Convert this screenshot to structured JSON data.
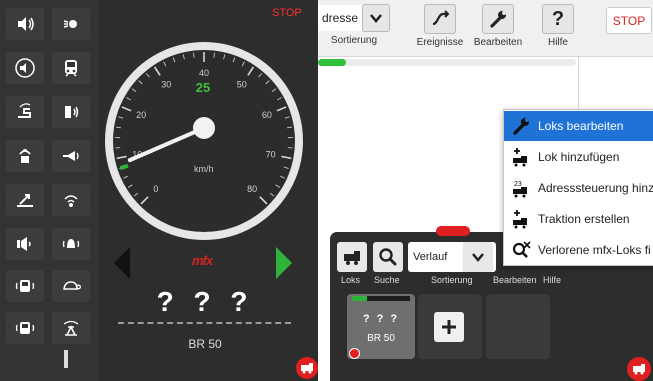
{
  "left": {
    "stop_label": "STOP",
    "speed_value": "25",
    "speed_unit": "km/h",
    "speed_fraction": 0.25,
    "gauge_ticks": [
      "0",
      "10",
      "20",
      "30",
      "40",
      "50",
      "60",
      "70",
      "80"
    ],
    "loco_name_placeholder": "? ? ?",
    "loco_name": "BR 50",
    "mfx_logo": "mfx"
  },
  "toolbar": {
    "address_label": "dresse",
    "sort_label": "Sortierung",
    "events_label": "Ereignisse",
    "edit_label": "Bearbeiten",
    "help_label": "Hilfe",
    "stop_label": "STOP",
    "progress": 0.11
  },
  "menu": {
    "items": [
      {
        "label": "Loks bearbeiten",
        "icon": "wrench-icon",
        "active": true
      },
      {
        "label": "Lok hinzufügen",
        "icon": "loco-add-icon",
        "active": false
      },
      {
        "label": "Adresssteuerung hinz",
        "icon": "address-control-icon",
        "active": false
      },
      {
        "label": "Traktion erstellen",
        "icon": "traction-icon",
        "active": false
      },
      {
        "label": "Verlorene mfx-Loks fi",
        "icon": "lost-mfx-icon",
        "active": false
      }
    ]
  },
  "bottom": {
    "loks_label": "Loks",
    "search_label": "Suche",
    "sort_value": "Verlauf",
    "sort_label": "Sortierung",
    "edit_label": "Bearbeiten",
    "help_label": "Hilfe",
    "card_qm": "? ? ?",
    "card_name": "BR 50",
    "card_progress": 0.25
  },
  "colors": {
    "accent_green": "#2fb33b",
    "stop_red": "#e02020",
    "menu_highlight": "#1f73d6"
  }
}
